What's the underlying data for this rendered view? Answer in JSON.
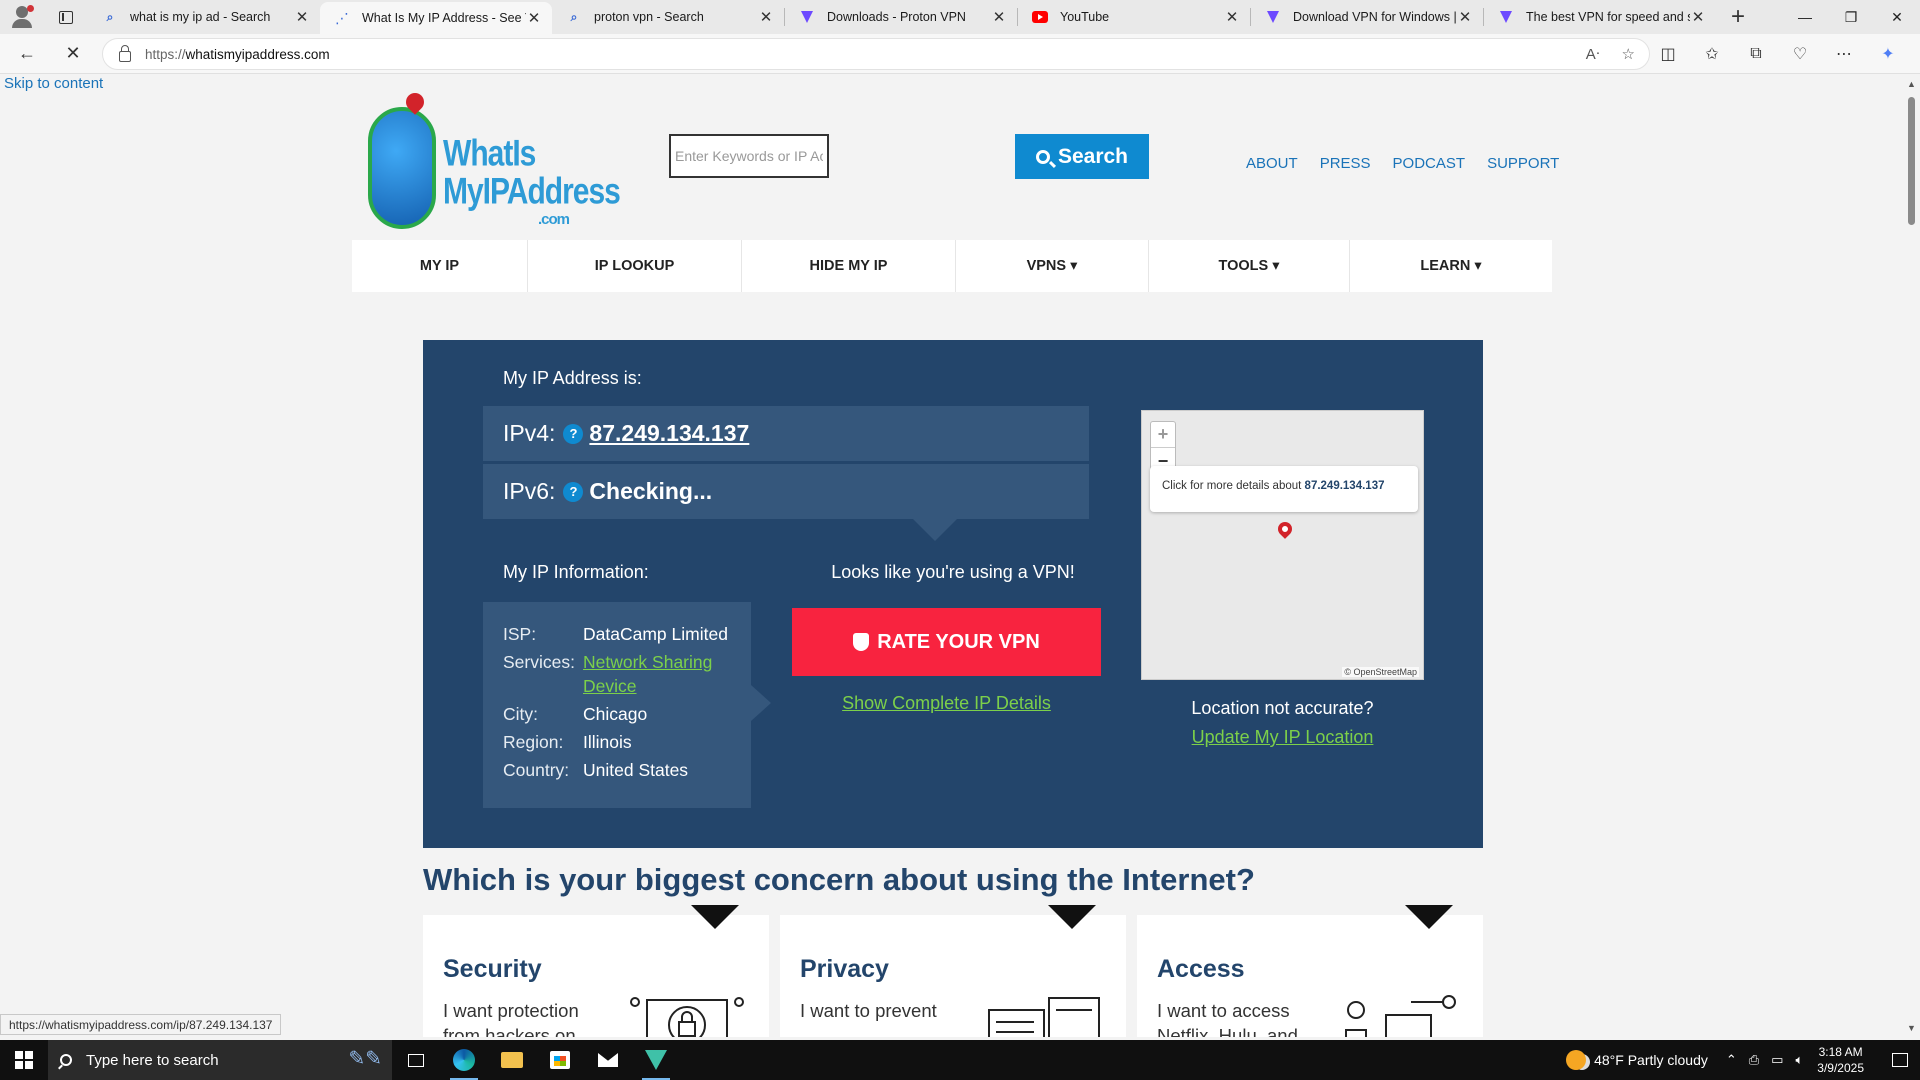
{
  "browser": {
    "tabs": [
      {
        "title": "what is my ip ad - Search",
        "icon": "search-favicon",
        "active": false
      },
      {
        "title": "What Is My IP Address - See You",
        "icon": "loading-favicon",
        "active": true
      },
      {
        "title": "proton vpn - Search",
        "icon": "search-favicon",
        "active": false
      },
      {
        "title": "Downloads - Proton VPN",
        "icon": "proton-favicon",
        "active": false
      },
      {
        "title": "YouTube",
        "icon": "youtube-favicon",
        "active": false
      },
      {
        "title": "Download VPN for Windows | P",
        "icon": "proton-favicon",
        "active": false
      },
      {
        "title": "The best VPN for speed and sec",
        "icon": "proton-favicon",
        "active": false
      }
    ],
    "url_scheme": "https://",
    "url_host": "whatismyipaddress.com",
    "status_url": "https://whatismyipaddress.com/ip/87.249.134.137"
  },
  "site": {
    "skip_link": "Skip to content",
    "logo": {
      "line1": "WhatIs",
      "line2": "MyIPAddress",
      "line3": ".com"
    },
    "search_placeholder": "Enter Keywords or IP Ac",
    "search_button": "Search",
    "top_links": [
      "ABOUT",
      "PRESS",
      "PODCAST",
      "SUPPORT"
    ],
    "nav": [
      "MY IP",
      "IP LOOKUP",
      "HIDE MY IP",
      "VPNS ▾",
      "TOOLS ▾",
      "LEARN ▾"
    ]
  },
  "ip": {
    "heading": "My IP Address is:",
    "ipv4_label": "IPv4:",
    "ipv4_value": "87.249.134.137",
    "ipv6_label": "IPv6:",
    "ipv6_value": "Checking...",
    "info_heading": "My IP Information:",
    "vpn_notice": "Looks like you're using a VPN!",
    "isp_label": "ISP:",
    "isp": "DataCamp Limited",
    "services_label": "Services:",
    "services": "Network Sharing Device",
    "city_label": "City:",
    "city": "Chicago",
    "region_label": "Region:",
    "region": "Illinois",
    "country_label": "Country:",
    "country": "United States",
    "rate_button": "RATE YOUR VPN",
    "show_details": "Show Complete IP Details",
    "map_popup_prefix": "Click for more details about ",
    "map_popup_ip": "87.249.134.137",
    "map_attribution": "© OpenStreetMap",
    "location_question": "Location not accurate?",
    "update_location": "Update My IP Location"
  },
  "concerns": {
    "heading": "Which is your biggest concern about using the Internet?",
    "cards": [
      {
        "title": "Security",
        "desc": "I want protection from hackers on"
      },
      {
        "title": "Privacy",
        "desc": "I want to prevent"
      },
      {
        "title": "Access",
        "desc": "I want to access Netflix, Hulu, and"
      }
    ]
  },
  "taskbar": {
    "search_placeholder": "Type here to search",
    "weather": "48°F  Partly cloudy",
    "time": "3:18 AM",
    "date": "3/9/2025"
  },
  "colors": {
    "ip_panel": "#23456b",
    "ip_row": "#35577c",
    "accent_blue": "#0f8ad0",
    "rate_red": "#f8233f",
    "link_green": "#7cd04a"
  }
}
